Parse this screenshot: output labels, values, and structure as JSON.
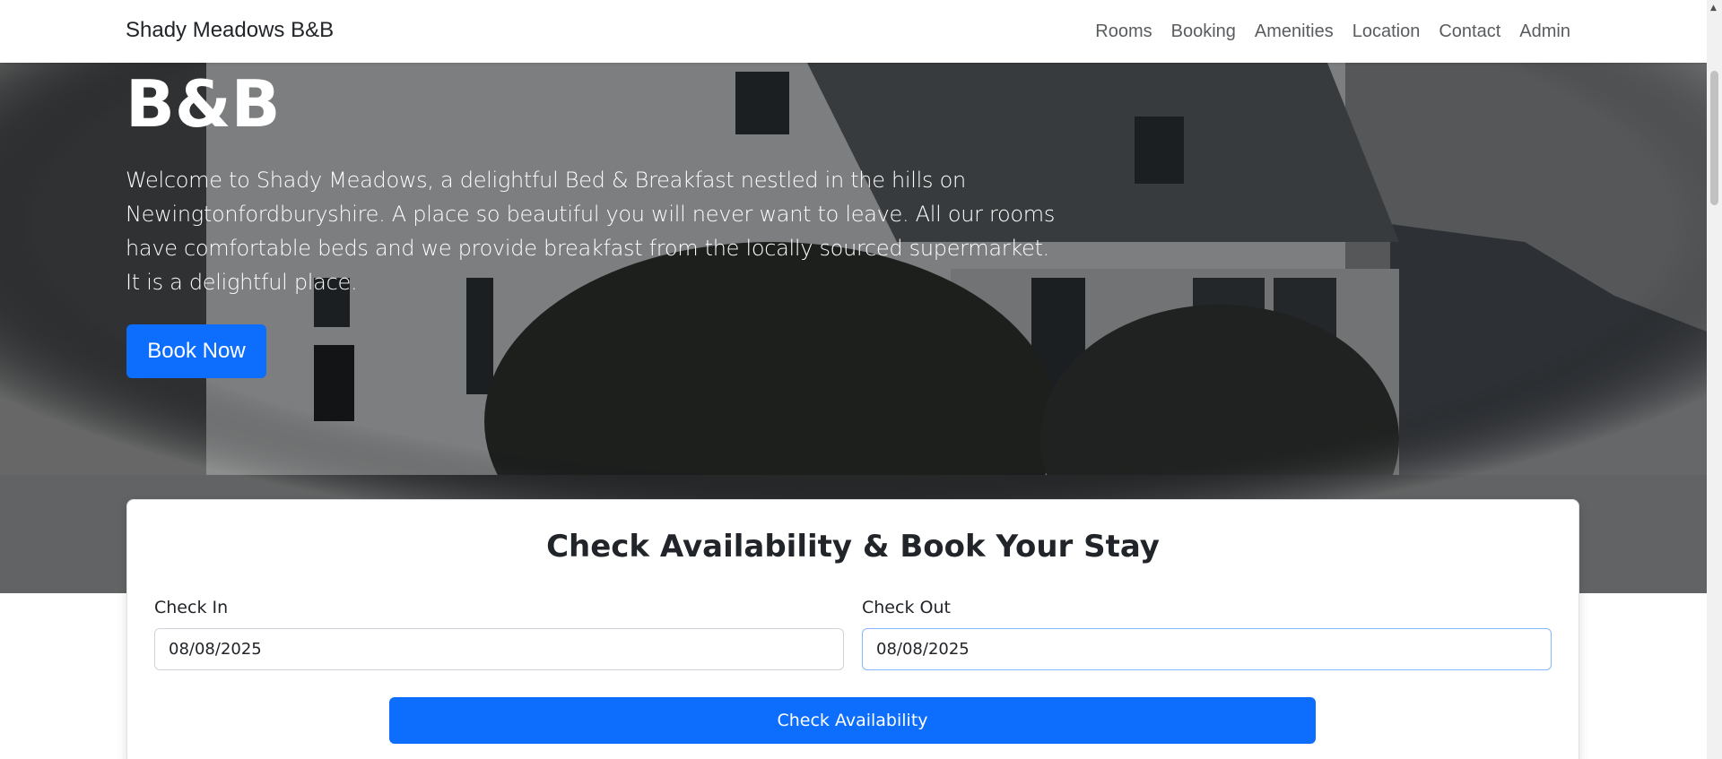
{
  "navbar": {
    "brand": "Shady Meadows B&B",
    "links": [
      "Rooms",
      "Booking",
      "Amenities",
      "Location",
      "Contact",
      "Admin"
    ]
  },
  "hero": {
    "title": "B&B",
    "description": "Welcome to Shady Meadows, a delightful Bed & Breakfast nestled in the hills on Newingtonfordburyshire. A place so beautiful you will never want to leave. All our rooms have comfortable beds and we provide breakfast from the locally sourced supermarket. It is a delightful place.",
    "book_now_label": "Book Now"
  },
  "booking": {
    "title": "Check Availability & Book Your Stay",
    "check_in_label": "Check In",
    "check_in_value": "08/08/2025",
    "check_out_label": "Check Out",
    "check_out_value": "08/08/2025",
    "check_button_label": "Check Availability"
  },
  "colors": {
    "primary": "#0d6efd",
    "text": "#212529",
    "nav_link": "#595c5f"
  }
}
